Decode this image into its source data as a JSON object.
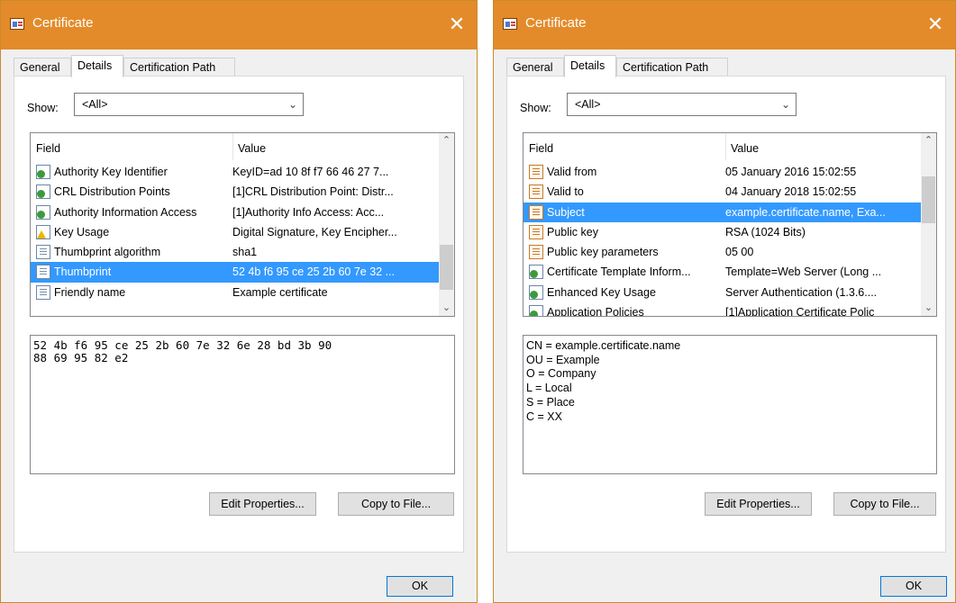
{
  "left": {
    "title": "Certificate",
    "close_glyph": "✕",
    "tabs": [
      {
        "label": "General"
      },
      {
        "label": "Details"
      },
      {
        "label": "Certification Path"
      }
    ],
    "show_label": "Show:",
    "show_value": "<All>",
    "columns": {
      "field": "Field",
      "value": "Value"
    },
    "rows": [
      {
        "icon": "extension-icon",
        "field": "Authority Key Identifier",
        "value": "KeyID=ad 10 8f f7 66 46 27 7..."
      },
      {
        "icon": "extension-icon",
        "field": "CRL Distribution Points",
        "value": "[1]CRL Distribution Point: Distr..."
      },
      {
        "icon": "extension-icon",
        "field": "Authority Information Access",
        "value": "[1]Authority Info Access: Acc..."
      },
      {
        "icon": "critical-extension-icon",
        "field": "Key Usage",
        "value": "Digital Signature, Key Encipher..."
      },
      {
        "icon": "property-icon",
        "field": "Thumbprint algorithm",
        "value": "sha1"
      },
      {
        "icon": "property-icon",
        "field": "Thumbprint",
        "value": "52 4b f6 95 ce 25 2b 60 7e 32 ...",
        "selected": true
      },
      {
        "icon": "property-icon",
        "field": "Friendly name",
        "value": "Example certificate"
      }
    ],
    "detail_lines": [
      "52 4b f6 95 ce 25 2b 60 7e 32 6e 28 bd 3b 90",
      "88 69 95 82 e2"
    ],
    "edit_button": "Edit Properties...",
    "copy_button": "Copy to File...",
    "ok_button": "OK"
  },
  "right": {
    "title": "Certificate",
    "close_glyph": "✕",
    "tabs": [
      {
        "label": "General"
      },
      {
        "label": "Details"
      },
      {
        "label": "Certification Path"
      }
    ],
    "show_label": "Show:",
    "show_value": "<All>",
    "columns": {
      "field": "Field",
      "value": "Value"
    },
    "rows": [
      {
        "icon": "certificate-field-icon",
        "field": "Valid from",
        "value": "05 January 2016 15:02:55"
      },
      {
        "icon": "certificate-field-icon",
        "field": "Valid to",
        "value": "04 January 2018 15:02:55"
      },
      {
        "icon": "certificate-field-icon",
        "field": "Subject",
        "value": "example.certificate.name, Exa...",
        "selected": true
      },
      {
        "icon": "certificate-field-icon",
        "field": "Public key",
        "value": "RSA (1024 Bits)"
      },
      {
        "icon": "certificate-field-icon",
        "field": "Public key parameters",
        "value": "05 00"
      },
      {
        "icon": "extension-icon",
        "field": "Certificate Template Inform...",
        "value": "Template=Web Server (Long ..."
      },
      {
        "icon": "extension-icon",
        "field": "Enhanced Key Usage",
        "value": "Server Authentication (1.3.6...."
      },
      {
        "icon": "extension-icon",
        "field": "Application Policies",
        "value": "[1]Application Certificate Polic"
      }
    ],
    "detail_lines": [
      "CN = example.certificate.name",
      "OU = Example",
      "O = Company",
      "L = Local",
      "S = Place",
      "C = XX"
    ],
    "edit_button": "Edit Properties...",
    "copy_button": "Copy to File...",
    "ok_button": "OK"
  },
  "colors": {
    "titlebar": "#e38b2a",
    "selection": "#3399ff",
    "ok_border": "#0078d7"
  }
}
